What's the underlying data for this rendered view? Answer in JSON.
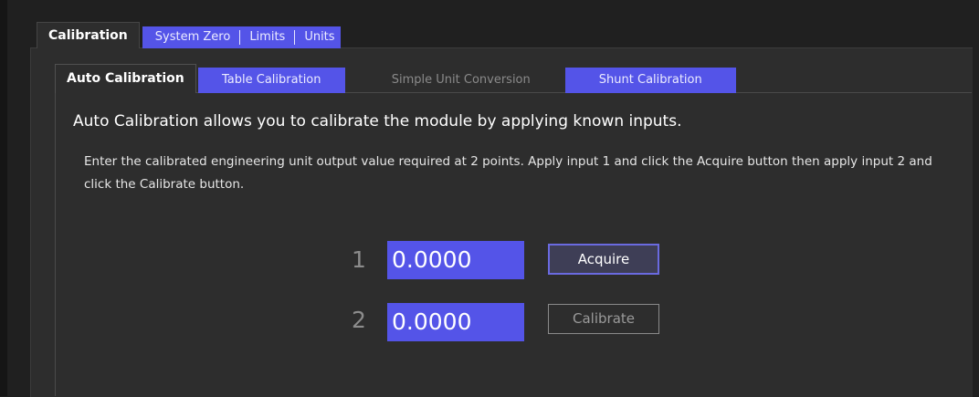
{
  "outer_tabs": {
    "active": "Calibration",
    "others": [
      "System Zero",
      "Limits",
      "Units"
    ]
  },
  "inner_tabs": {
    "active": "Auto Calibration",
    "table_calibration": "Table Calibration",
    "simple_unit_conversion": "Simple Unit Conversion",
    "shunt_calibration": "Shunt Calibration"
  },
  "content": {
    "heading": "Auto Calibration allows you to calibrate the module by applying known inputs.",
    "description": "Enter the calibrated engineering unit output value required at 2 points. Apply input 1 and click the Acquire button then apply input 2 and click the Calibrate button."
  },
  "points": [
    {
      "label": "1",
      "value": "0.0000",
      "button": "Acquire"
    },
    {
      "label": "2",
      "value": "0.0000",
      "button": "Calibrate"
    }
  ],
  "colors": {
    "accent": "#5454e8",
    "panel": "#2d2d2d",
    "background": "#202020"
  }
}
